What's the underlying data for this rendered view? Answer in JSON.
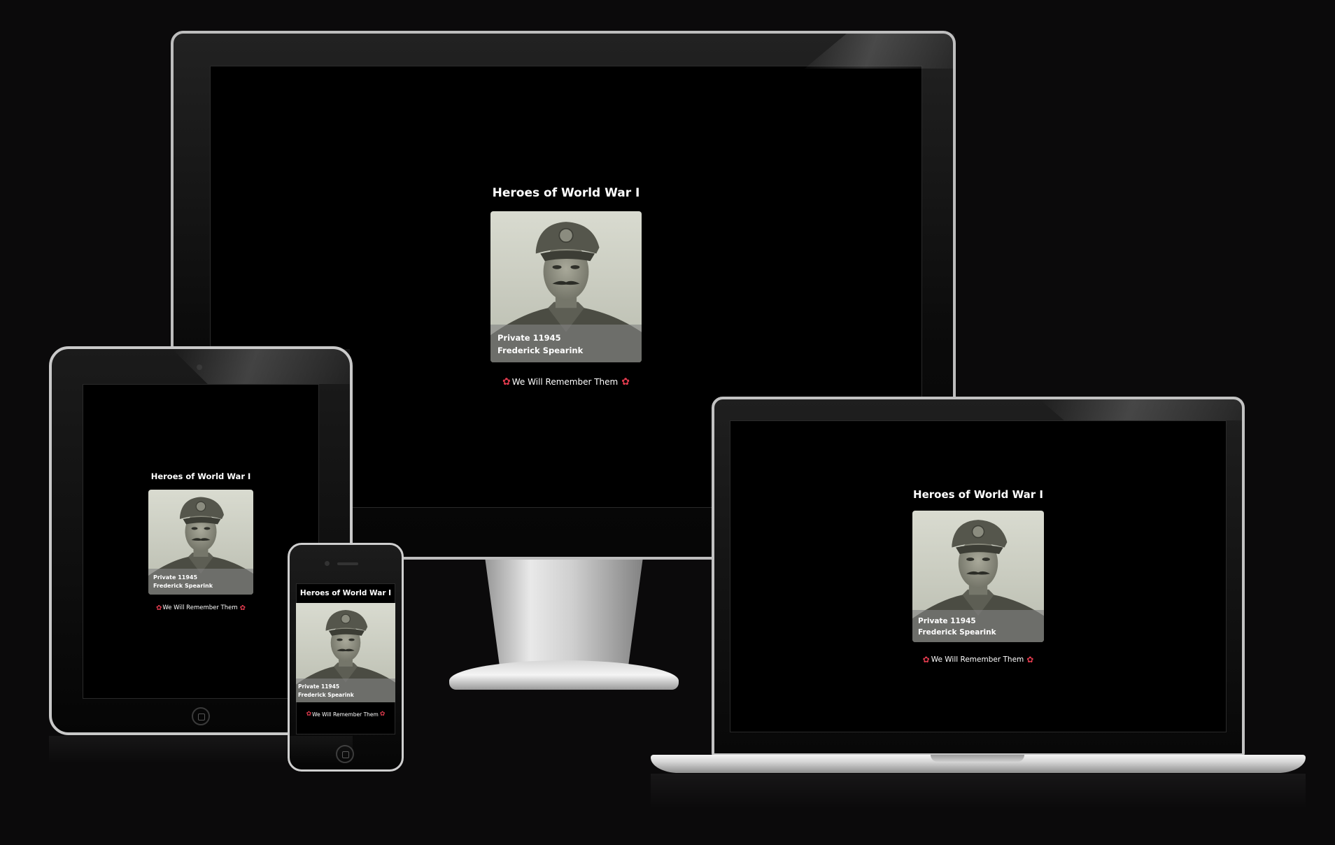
{
  "page": {
    "title": "Heroes of World War I",
    "soldier": {
      "rank_number": "Private 11945",
      "name": "Frederick Spearink"
    },
    "footer_text": "We Will Remember Them",
    "poppy_icon": "poppy-icon"
  },
  "colors": {
    "background": "#0b0a0b",
    "screen": "#000000",
    "poppy": "#e23b4e",
    "caption_overlay": "rgba(130,130,130,0.62)"
  }
}
